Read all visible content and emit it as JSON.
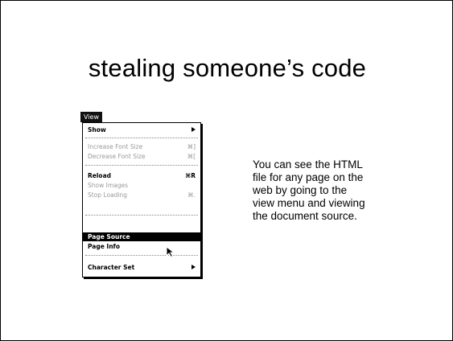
{
  "slide": {
    "title": "stealing someone’s code",
    "body_lines": [
      "You can see the HTML",
      "file for any page on the",
      "web by going to the",
      "view menu and viewing",
      "the document source."
    ]
  },
  "menu": {
    "title": "View",
    "items": {
      "show": "Show",
      "increase_font": "Increase Font Size",
      "increase_font_shortcut": "⌘]",
      "decrease_font": "Decrease Font Size",
      "decrease_font_shortcut": "⌘[",
      "reload": "Reload",
      "reload_shortcut": "⌘R",
      "show_images": "Show Images",
      "stop_loading": "Stop Loading",
      "stop_loading_shortcut": "⌘.",
      "page_source": "Page Source",
      "page_info": "Page Info",
      "character_set": "Character Set"
    }
  },
  "colors": {
    "highlight": "#000000",
    "disabled_text": "#9a9a9a"
  }
}
